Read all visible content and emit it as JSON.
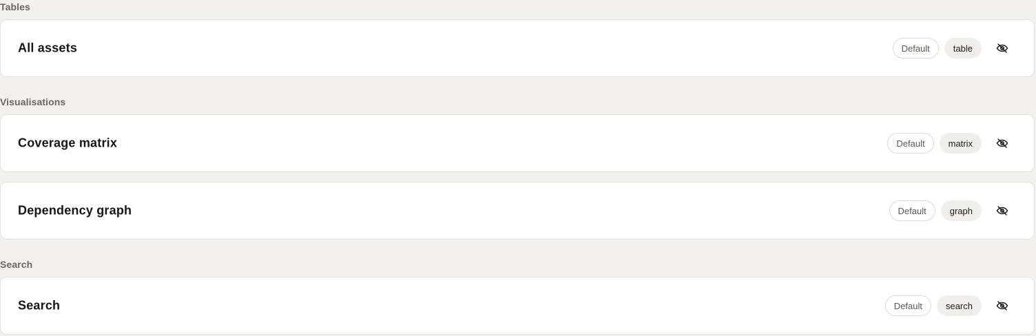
{
  "sections": [
    {
      "label": "Tables",
      "cards": [
        {
          "title": "All assets",
          "default_label": "Default",
          "type_label": "table",
          "icon": "eye-off-icon"
        }
      ]
    },
    {
      "label": "Visualisations",
      "cards": [
        {
          "title": "Coverage matrix",
          "default_label": "Default",
          "type_label": "matrix",
          "icon": "eye-off-icon"
        },
        {
          "title": "Dependency graph",
          "default_label": "Default",
          "type_label": "graph",
          "icon": "eye-off-icon"
        }
      ]
    },
    {
      "label": "Search",
      "cards": [
        {
          "title": "Search",
          "default_label": "Default",
          "type_label": "search",
          "icon": "eye-off-icon"
        }
      ]
    }
  ],
  "colors": {
    "background": "#f3f1ed",
    "card": "#ffffff",
    "section_label": "#6b6660",
    "type_pill_bg": "#f1efeb"
  }
}
